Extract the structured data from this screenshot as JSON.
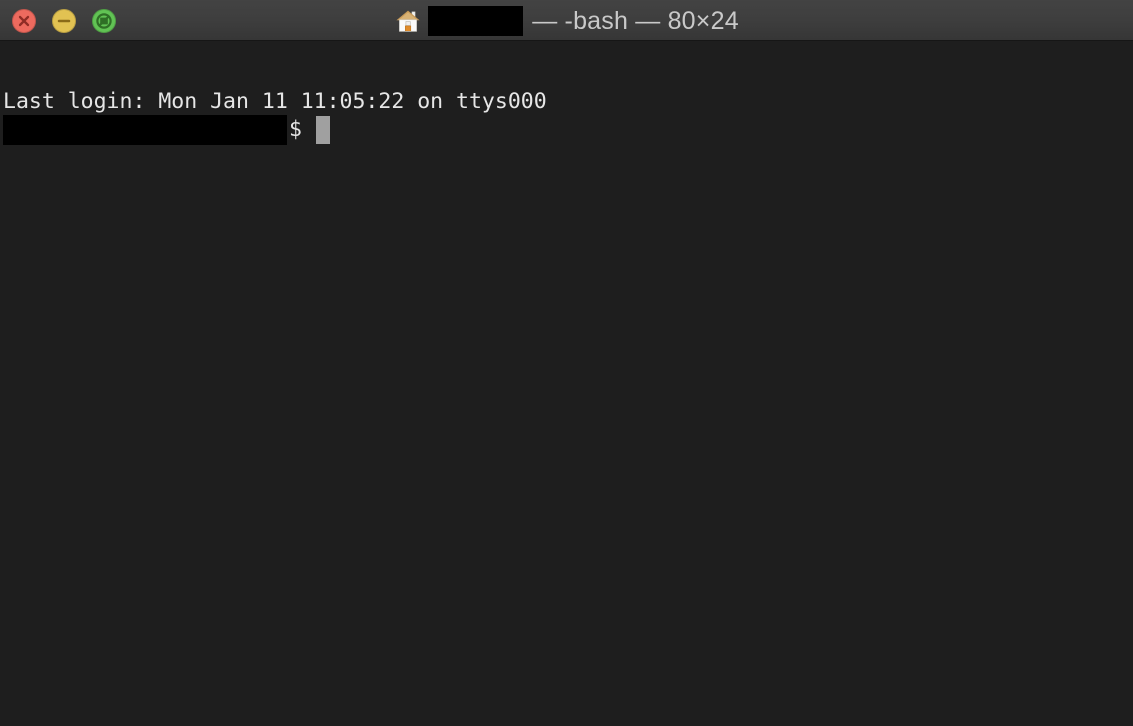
{
  "window": {
    "app": "Terminal",
    "titlebar": {
      "home_icon": "home-folder-icon",
      "redacted_title_segment": "",
      "title_text": "— -bash — 80×24",
      "shell": "-bash",
      "size": "80×24",
      "background_color": "#3e3e3e",
      "title_color": "#c9c9c9"
    },
    "controls": [
      {
        "name": "close",
        "glyph": "×",
        "color": "#ed6a5e",
        "symbol_color": "#8f2c25"
      },
      {
        "name": "minimize",
        "glyph": "−",
        "color": "#e2c252",
        "symbol_color": "#8a6a18"
      },
      {
        "name": "zoom",
        "glyph": "⦸",
        "color": "#61c354",
        "symbol_color": "#2c6b23"
      }
    ]
  },
  "terminal": {
    "background_color": "#1e1e1e",
    "foreground_color": "#e6e6e6",
    "cursor_color": "#a0a0a0",
    "lines": [
      {
        "id": "last-login",
        "text": "Last login: Mon Jan 11 11:05:22 on ttys000"
      }
    ],
    "prompt": {
      "redacted_host_path": "",
      "sigil": "$",
      "input_value": "",
      "cursor": "block"
    }
  }
}
